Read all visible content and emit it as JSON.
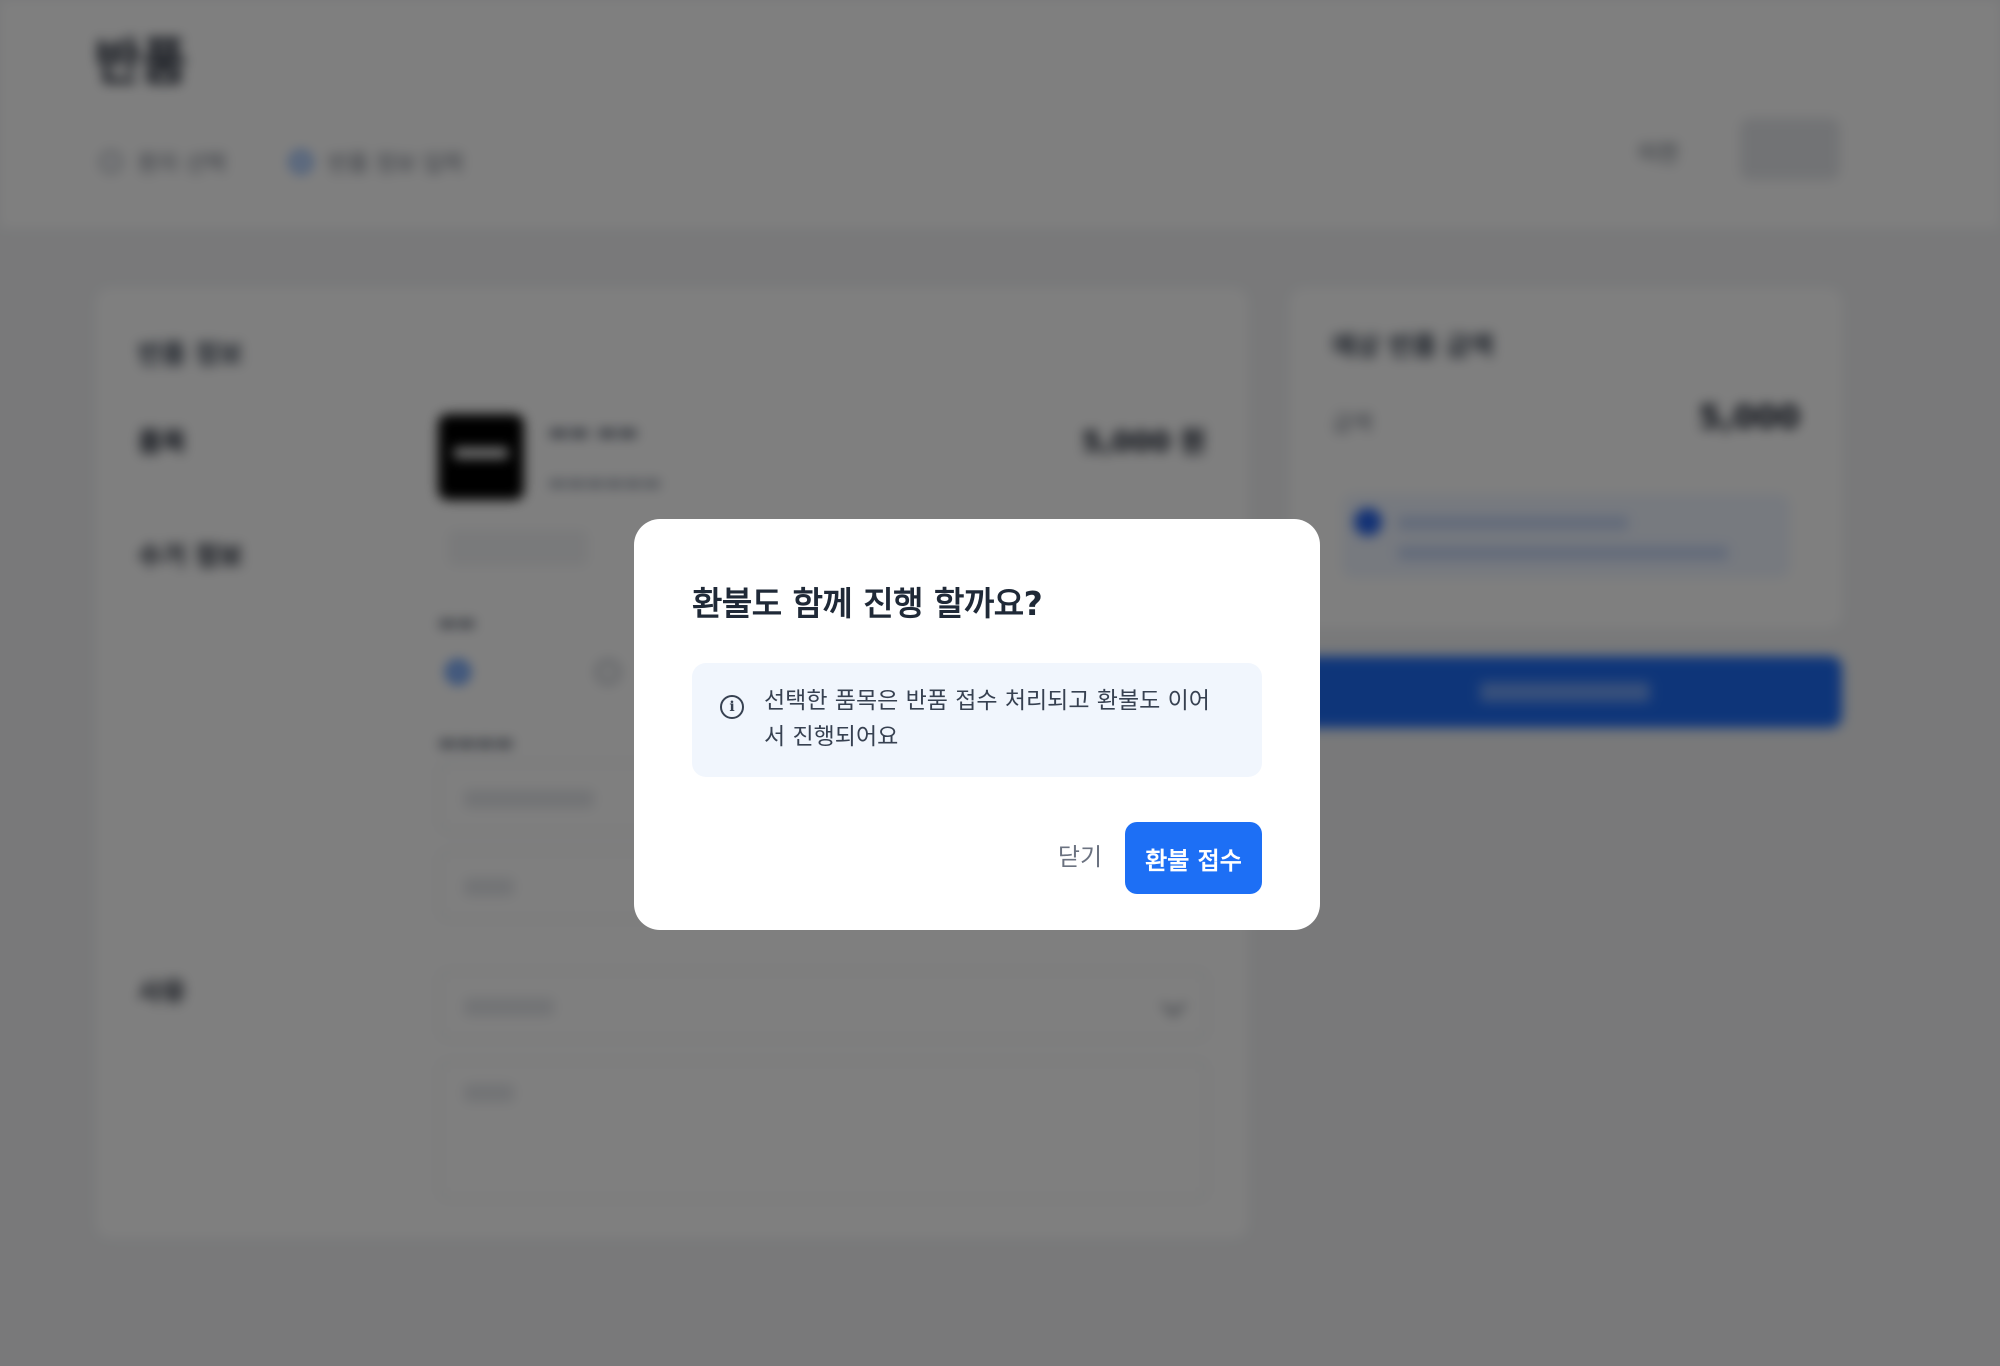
{
  "background": {
    "page_title": "반품",
    "steps": [
      "환자 선택",
      "반품 정보 입력"
    ],
    "top_link": "이전",
    "left_card_title": "반품 정보",
    "rows": [
      "품목",
      "수거 정보",
      "사유"
    ],
    "product_price": "5,000 원",
    "right_card_title": "예상 반품 금액",
    "summary_label": "금액",
    "summary_value": "5,000"
  },
  "modal": {
    "title": "환불도 함께 진행 할까요?",
    "info_icon": "info-icon",
    "info_text": "선택한 품목은 반품 접수 처리되고 환불도 이어서 진행되어요",
    "close_label": "닫기",
    "confirm_label": "환불 접수",
    "confirm_color": "#1d6ff5"
  }
}
